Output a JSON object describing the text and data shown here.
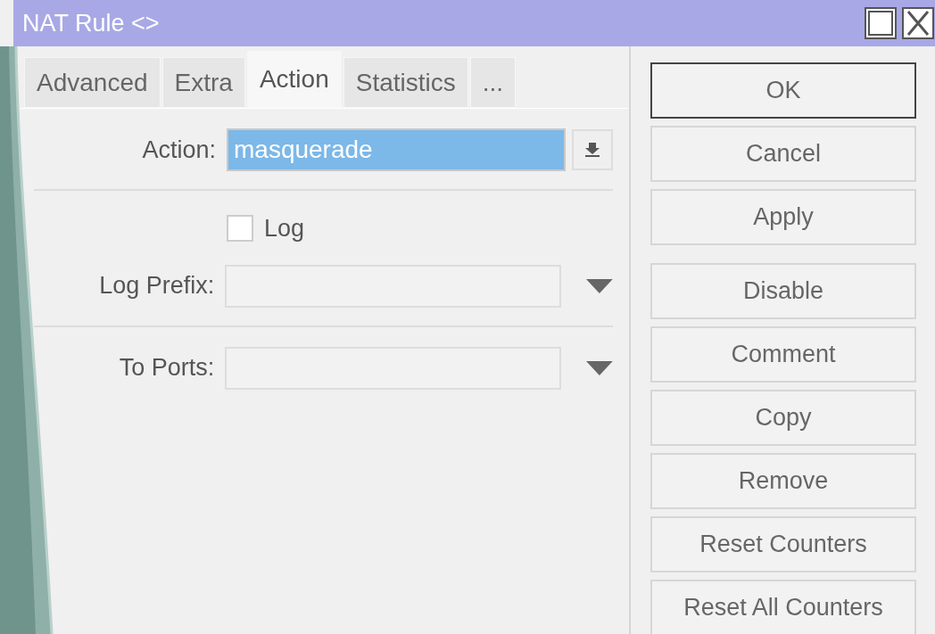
{
  "window": {
    "title": "NAT Rule <>"
  },
  "tabs": [
    {
      "label": "Advanced",
      "selected": false
    },
    {
      "label": "Extra",
      "selected": false
    },
    {
      "label": "Action",
      "selected": true
    },
    {
      "label": "Statistics",
      "selected": false
    },
    {
      "label": "...",
      "selected": false
    }
  ],
  "sections": [
    [
      {
        "kind": "select",
        "label": "Action:",
        "value": "masquerade",
        "selected": true
      }
    ],
    [
      {
        "kind": "checkbox",
        "label": "Log",
        "checked": false
      },
      {
        "kind": "combo",
        "label": "Log Prefix:"
      }
    ],
    [
      {
        "kind": "combo",
        "label": "To Ports:"
      }
    ]
  ],
  "button_groups": [
    [
      {
        "label": "OK",
        "default": true
      },
      {
        "label": "Cancel",
        "default": false
      },
      {
        "label": "Apply",
        "default": false
      }
    ],
    [
      {
        "label": "Disable",
        "default": false
      },
      {
        "label": "Comment",
        "default": false
      },
      {
        "label": "Copy",
        "default": false
      },
      {
        "label": "Remove",
        "default": false
      },
      {
        "label": "Reset Counters",
        "default": false
      },
      {
        "label": "Reset All Counters",
        "default": false
      }
    ]
  ]
}
